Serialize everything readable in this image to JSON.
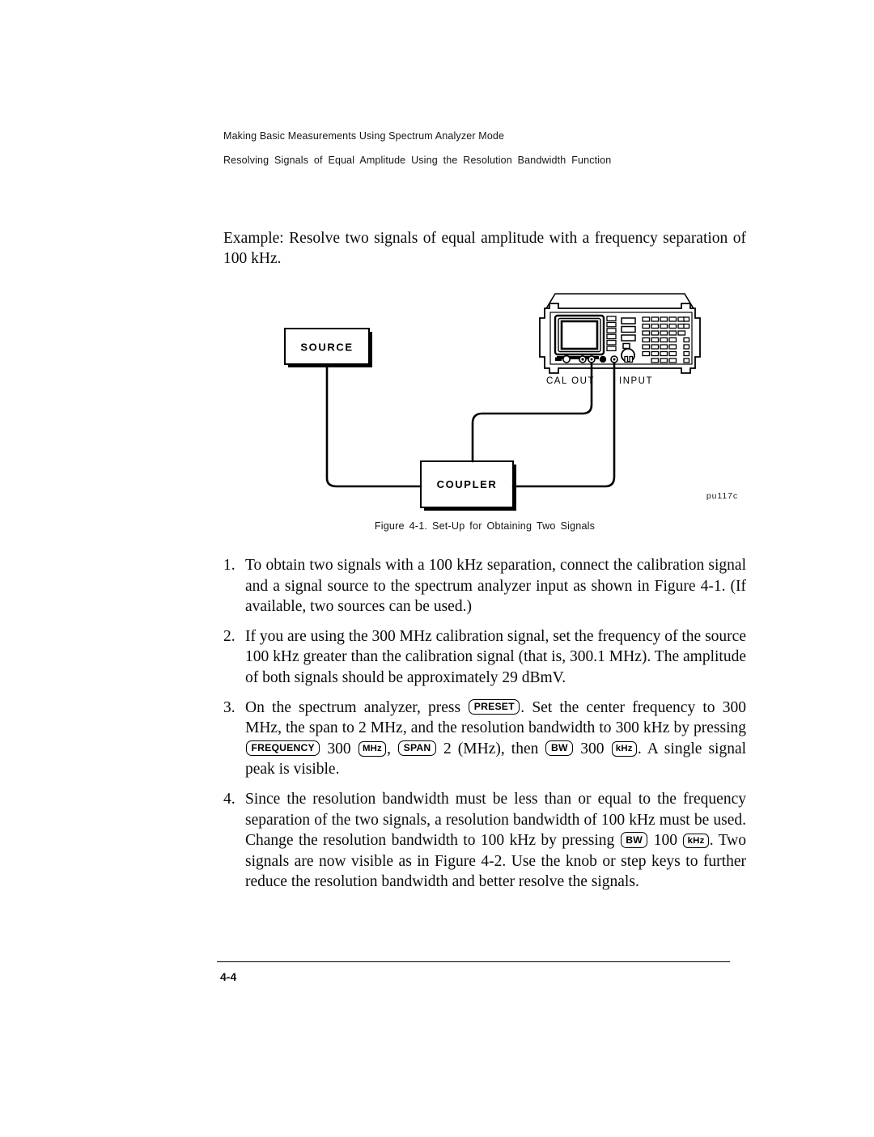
{
  "header": {
    "line1": "Making Basic Measurements Using Spectrum Analyzer Mode",
    "line2": "Resolving Signals of Equal Amplitude Using the Resolution Bandwidth Function"
  },
  "example": {
    "text": "Example: Resolve two signals of equal amplitude with a frequency separation of 100 kHz."
  },
  "figure": {
    "id_label": "pu117c",
    "caption": "Figure 4-1. Set-Up for Obtaining Two Signals",
    "blocks": {
      "source": "SOURCE",
      "coupler": "COUPLER"
    },
    "ports": {
      "cal_out": "CAL OUT",
      "input": "INPUT"
    }
  },
  "steps": [
    {
      "num": "1.",
      "text": "To obtain two signals with a 100 kHz separation, connect the calibration signal and a signal source to the spectrum analyzer input as shown in Figure 4-1. (If available, two sources can be used.)"
    },
    {
      "num": "2.",
      "text": "If you are using the 300 MHz calibration signal, set the frequency of the source 100 kHz greater than the calibration signal (that is, 300.1 MHz). The amplitude of both signals should be approximately 29 dBmV."
    },
    {
      "num": "3.",
      "parts": {
        "p1": "On the spectrum analyzer, press ",
        "k1": "PRESET",
        "p2": ". Set the center frequency to 300 MHz, the span to 2 MHz, and the resolution bandwidth to 300 kHz by pressing ",
        "k2": "FREQUENCY",
        "p3": " 300 ",
        "k3": "MHz",
        "p4": ", ",
        "k4": "SPAN",
        "p5": " 2 (MHz), then ",
        "k5": "BW",
        "p6": " 300 ",
        "k6": "kHz",
        "p7": ". A single signal peak is visible."
      }
    },
    {
      "num": "4.",
      "parts": {
        "p1": "Since the resolution bandwidth must be less than or equal to the frequency separation of the two signals, a resolution bandwidth of 100 kHz must be used. Change the resolution bandwidth to 100 kHz by pressing ",
        "k1": "BW",
        "p2": " 100 ",
        "k2": "kHz",
        "p3": ". Two signals are now visible as in Figure 4-2. Use the knob or step keys to further reduce the resolution bandwidth and better resolve the signals."
      }
    }
  ],
  "footer": {
    "page": "4-4"
  }
}
